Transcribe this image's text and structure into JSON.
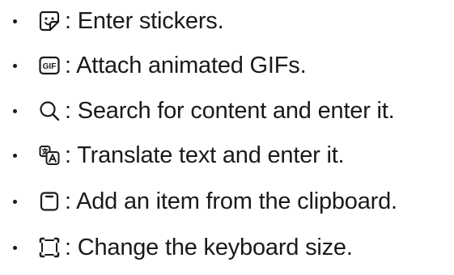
{
  "items": [
    {
      "icon": "sticker-icon",
      "text": ": Enter stickers."
    },
    {
      "icon": "gif-icon",
      "icon_label": "GIF",
      "text": ": Attach animated GIFs."
    },
    {
      "icon": "search-icon",
      "text": ": Search for content and enter it."
    },
    {
      "icon": "translate-icon",
      "text": ": Translate text and enter it."
    },
    {
      "icon": "clipboard-icon",
      "text": ": Add an item from the clipboard."
    },
    {
      "icon": "keyboard-size-icon",
      "text": ": Change the keyboard size."
    }
  ]
}
